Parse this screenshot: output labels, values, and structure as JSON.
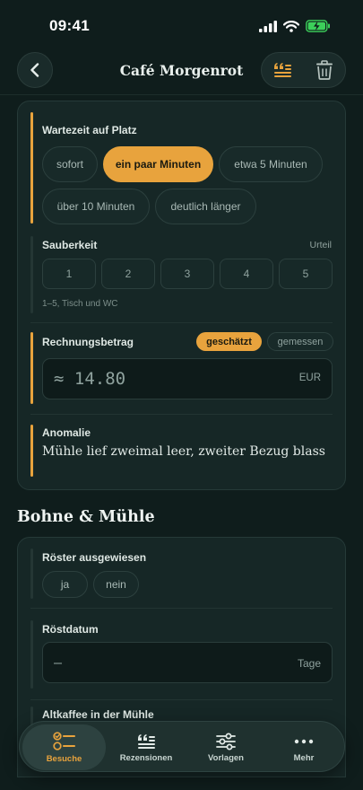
{
  "status": {
    "time": "09:41"
  },
  "header": {
    "title": "Café Morgenrot"
  },
  "icons": {
    "back": "chevron-left-icon",
    "review": "quote-list-icon",
    "delete": "trash-icon"
  },
  "colors": {
    "accent": "#e8a33d",
    "background": "#0f1d1c",
    "card": "#162726"
  },
  "wait": {
    "label": "Wartezeit auf Platz",
    "options": [
      "sofort",
      "ein paar Minuten",
      "etwa 5 Minuten",
      "über 10 Minuten",
      "deutlich länger"
    ],
    "selected": "ein paar Minuten"
  },
  "cleanliness": {
    "label": "Sauberkeit",
    "tag": "Urteil",
    "ratings": [
      "1",
      "2",
      "3",
      "4",
      "5"
    ],
    "hint": "1–5, Tisch und WC"
  },
  "bill": {
    "label": "Rechnungsbetrag",
    "modes": [
      "geschätzt",
      "gemessen"
    ],
    "selected_mode": "geschätzt",
    "value": "≈ 14.80",
    "unit": "EUR"
  },
  "anomaly": {
    "label": "Anomalie",
    "text": "Mühle lief zweimal leer, zweiter Bezug blass"
  },
  "section_bean": {
    "title": "Bohne & Mühle"
  },
  "roaster": {
    "label": "Röster ausgewiesen",
    "options": [
      "ja",
      "nein"
    ]
  },
  "roast_date": {
    "label": "Röstdatum",
    "value": "—",
    "unit": "Tage"
  },
  "old_coffee": {
    "label": "Altkaffee in der Mühle"
  },
  "tabs": [
    {
      "label": "Besuche",
      "icon": "checklist-icon",
      "active": true
    },
    {
      "label": "Rezensionen",
      "icon": "quote-list-icon",
      "active": false
    },
    {
      "label": "Vorlagen",
      "icon": "sliders-icon",
      "active": false
    },
    {
      "label": "Mehr",
      "icon": "more-dots-icon",
      "active": false
    }
  ]
}
